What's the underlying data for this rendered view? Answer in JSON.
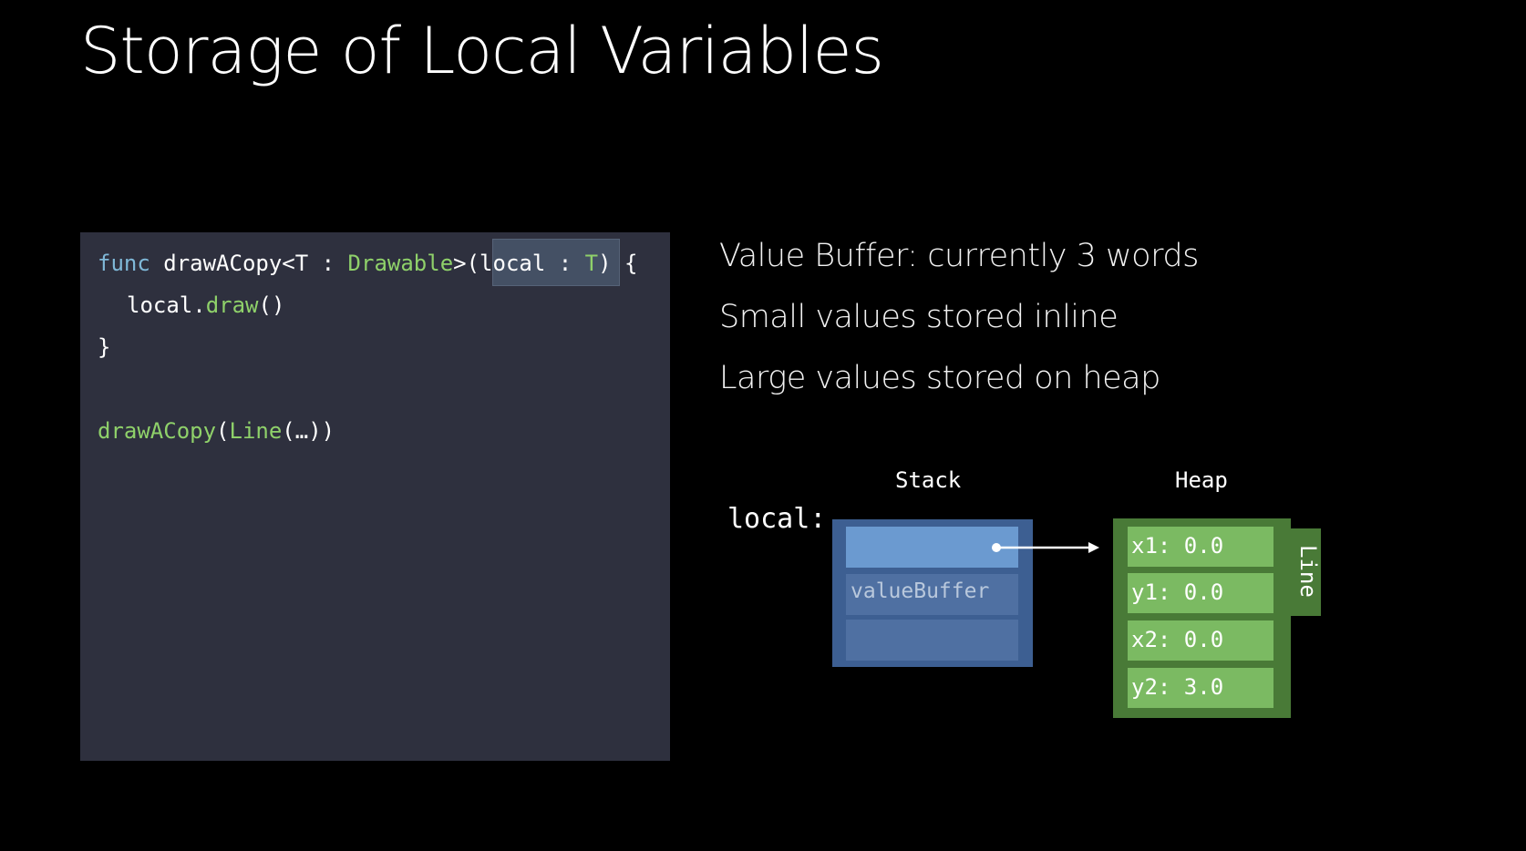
{
  "slide": {
    "title": "Storage of Local Variables"
  },
  "code": {
    "line1": {
      "kw": "func",
      "name": " drawACopy<T : ",
      "type": "Drawable",
      "open": ">(",
      "param": "local : ",
      "ptype": "T",
      "close": ") {"
    },
    "line2": {
      "obj": "local.",
      "method": "draw",
      "args": "()"
    },
    "line3": "}",
    "line5": {
      "fn": "drawACopy",
      "open": "(",
      "type": "Line",
      "args": "(…))"
    }
  },
  "bullets": [
    "Value Buffer: currently 3 words",
    "Small values stored inline",
    "Large values stored on heap"
  ],
  "diagram": {
    "stack_label": "Stack",
    "heap_label": "Heap",
    "local_label": "local:",
    "stack_slots": [
      "",
      "valueBuffer",
      ""
    ],
    "heap_fields": [
      "x1: 0.0",
      "y1: 0.0",
      "x2: 0.0",
      "y2: 3.0"
    ],
    "heap_type": "Line"
  },
  "colors": {
    "background": "#000000",
    "code_bg": "#2e303e",
    "keyword": "#7fb8d8",
    "type": "#8fd16a",
    "stack": "#3d5f92",
    "stack_slot": "#4f70a2",
    "stack_slot_active": "#6b9ad0",
    "heap": "#497a37",
    "heap_cell": "#7bba62"
  }
}
